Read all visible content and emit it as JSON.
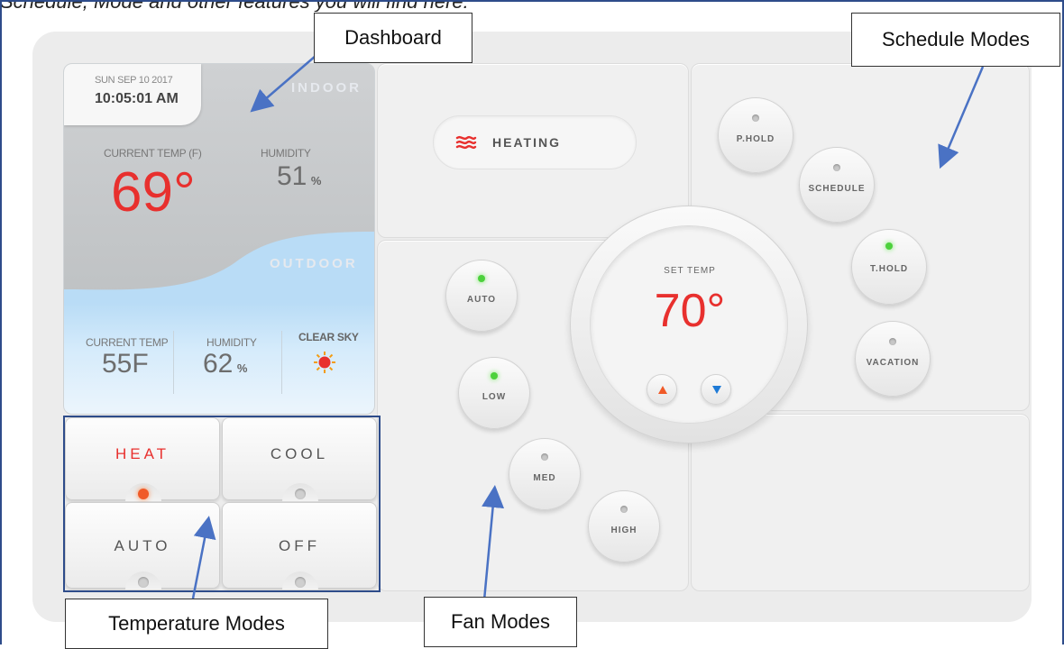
{
  "caption_text": "Schedule, Mode and other features you will find here:",
  "dashboard": {
    "date": "SUN SEP 10 2017",
    "time": "10:05:01 AM",
    "indoor": {
      "title": "INDOOR",
      "temp_label": "CURRENT TEMP (F)",
      "temp_value": "69°",
      "humidity_label": "HUMIDITY",
      "humidity_value": "51",
      "humidity_unit": "%"
    },
    "outdoor": {
      "title": "OUTDOOR",
      "temp_label": "CURRENT TEMP",
      "temp_value": "55F",
      "humidity_label": "HUMIDITY",
      "humidity_value": "62",
      "humidity_unit": "%",
      "condition_label": "CLEAR SKY",
      "condition_icon": "sun-icon"
    }
  },
  "temperature_modes": [
    {
      "label": "HEAT",
      "active": true,
      "color": "#e8302e"
    },
    {
      "label": "COOL",
      "active": false,
      "color": "#555555"
    },
    {
      "label": "AUTO",
      "active": false,
      "color": "#555555"
    },
    {
      "label": "OFF",
      "active": false,
      "color": "#555555"
    }
  ],
  "status": {
    "label": "HEATING",
    "icon": "heat-waves-icon",
    "icon_color": "#e8302e"
  },
  "thermostat": {
    "label": "SET TEMP",
    "value": "70°",
    "up_color": "#f05a28",
    "down_color": "#1e7ad6"
  },
  "fan_modes": [
    {
      "label": "AUTO",
      "active": true
    },
    {
      "label": "LOW",
      "active": true
    },
    {
      "label": "MED",
      "active": false
    },
    {
      "label": "HIGH",
      "active": false
    }
  ],
  "schedule_modes": [
    {
      "label": "P.HOLD",
      "active": false
    },
    {
      "label": "SCHEDULE",
      "active": false
    },
    {
      "label": "T.HOLD",
      "active": true
    },
    {
      "label": "VACATION",
      "active": false
    }
  ],
  "callouts": {
    "dashboard": "Dashboard",
    "schedule": "Schedule Modes",
    "temperature": "Temperature Modes",
    "fan": "Fan Modes"
  },
  "colors": {
    "accent_red": "#e8302e",
    "led_green": "#4cd13c",
    "annotation_blue": "#4a72c4",
    "frame_blue": "#2e4c8a"
  }
}
